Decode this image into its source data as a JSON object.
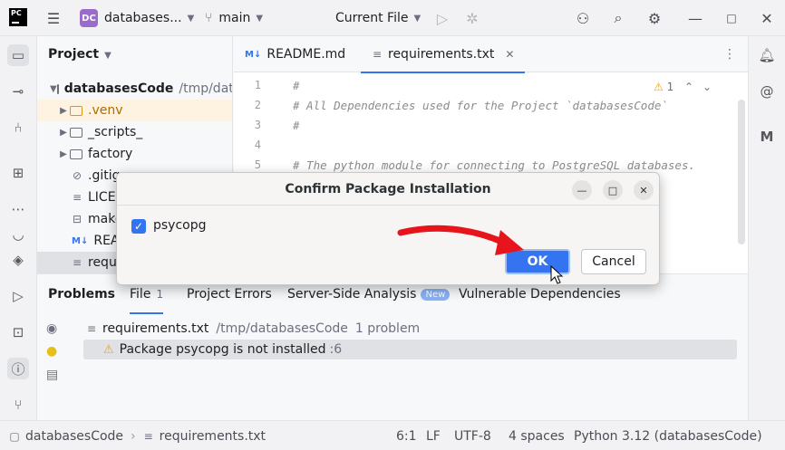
{
  "toolbar": {
    "logo": "PC",
    "project_badge": "DC",
    "project_name": "databases...",
    "branch": "main",
    "run_config": "Current File"
  },
  "project_panel": {
    "title": "Project",
    "root_name": "databasesCode",
    "root_path": "/tmp/data",
    "items": [
      {
        "label": ".venv"
      },
      {
        "label": "_scripts_"
      },
      {
        "label": "factory"
      },
      {
        "label": ".gitig"
      },
      {
        "label": "LICE"
      },
      {
        "label": "make"
      },
      {
        "label": "READ"
      },
      {
        "label": "requ"
      }
    ]
  },
  "editor": {
    "tabs": [
      {
        "label": "README.md"
      },
      {
        "label": "requirements.txt"
      }
    ],
    "warning_count": "1",
    "lines": [
      {
        "num": "1",
        "text": "#"
      },
      {
        "num": "2",
        "text": "# All Dependencies used for the Project `databasesCode`"
      },
      {
        "num": "3",
        "text": "#"
      },
      {
        "num": "4",
        "text": ""
      },
      {
        "num": "5",
        "text": "# The python module for connecting to PostgreSQL databases."
      }
    ]
  },
  "problems": {
    "tabs": [
      {
        "label": "Problems"
      },
      {
        "label": "File",
        "count": "1"
      },
      {
        "label": "Project Errors"
      },
      {
        "label": "Server-Side Analysis",
        "badge": "New"
      },
      {
        "label": "Vulnerable Dependencies"
      }
    ],
    "file": {
      "name": "requirements.txt",
      "path": "/tmp/databasesCode",
      "summary": "1 problem"
    },
    "issue": {
      "text": "Package psycopg is not installed",
      "location": ":6"
    }
  },
  "dialog": {
    "title": "Confirm Package Installation",
    "package": "psycopg",
    "ok": "OK",
    "cancel": "Cancel"
  },
  "statusbar": {
    "project": "databasesCode",
    "file": "requirements.txt",
    "position": "6:1",
    "line_sep": "LF",
    "encoding": "UTF-8",
    "indent": "4 spaces",
    "interpreter": "Python 3.12 (databasesCode)"
  },
  "colors": {
    "accent": "#3574f0",
    "annotation_arrow": "#e8141b",
    "warning": "#e5a61a"
  }
}
